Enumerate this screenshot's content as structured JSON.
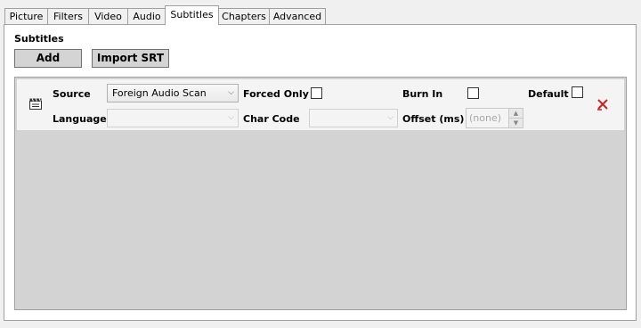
{
  "tabs": [
    {
      "label": "Picture",
      "active": false
    },
    {
      "label": "Filters",
      "active": false
    },
    {
      "label": "Video",
      "active": false
    },
    {
      "label": "Audio",
      "active": false
    },
    {
      "label": "Subtitles",
      "active": true
    },
    {
      "label": "Chapters",
      "active": false
    },
    {
      "label": "Advanced",
      "active": false
    }
  ],
  "subtitles": {
    "section_title": "Subtitles",
    "add_label": "Add",
    "import_label": "Import SRT",
    "track": {
      "icon": "subtitle-clapper-icon",
      "source_label": "Source",
      "source_value": "Foreign Audio Scan",
      "forced_only_label": "Forced Only",
      "forced_only_checked": false,
      "burn_in_label": "Burn In",
      "burn_in_checked": false,
      "default_label": "Default",
      "default_checked": false,
      "language_label": "Language",
      "language_value": "",
      "char_code_label": "Char Code",
      "char_code_value": "",
      "offset_label": "Offset (ms)",
      "offset_value": "(none)",
      "remove_icon": "remove-x-icon"
    }
  },
  "colors": {
    "remove_icon": "#cc2222",
    "list_background": "#d3d3d3"
  }
}
